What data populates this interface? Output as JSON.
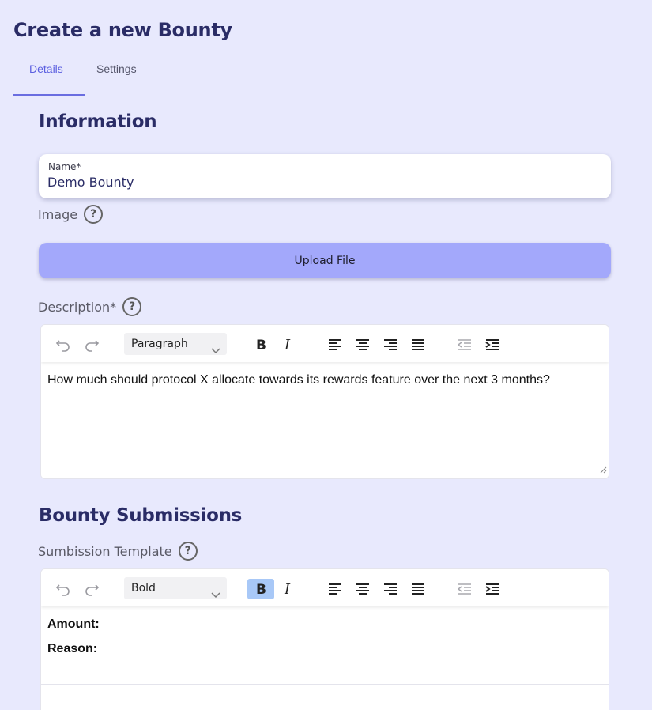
{
  "page": {
    "title": "Create a new Bounty"
  },
  "tabs": [
    {
      "label": "Details",
      "active": true
    },
    {
      "label": "Settings",
      "active": false
    }
  ],
  "information": {
    "title": "Information",
    "name_label": "Name*",
    "name_value": "Demo Bounty",
    "image_label": "Image",
    "upload_label": "Upload File",
    "description_label": "Description*",
    "description_editor": {
      "block_format": "Paragraph",
      "content": "How much should protocol X allocate towards its rewards feature over the next 3 months?"
    }
  },
  "submissions": {
    "title": "Bounty Submissions",
    "template_label": "Sumbission Template",
    "template_editor": {
      "block_format": "Bold",
      "bold_active": true,
      "lines": [
        "Amount:",
        "Reason:"
      ]
    }
  },
  "help_glyph": "?",
  "colors": {
    "background": "#e8e9fd",
    "accent": "#5b5fe0",
    "upload_button": "#a3a8fb",
    "heading": "#2a2c66",
    "bold_active": "#a8c8f7"
  },
  "icons": [
    "undo-icon",
    "redo-icon",
    "chevron-down-icon",
    "bold-icon",
    "italic-icon",
    "align-left-icon",
    "align-center-icon",
    "align-right-icon",
    "align-justify-icon",
    "outdent-icon",
    "indent-icon",
    "help-icon",
    "resize-handle-icon"
  ]
}
